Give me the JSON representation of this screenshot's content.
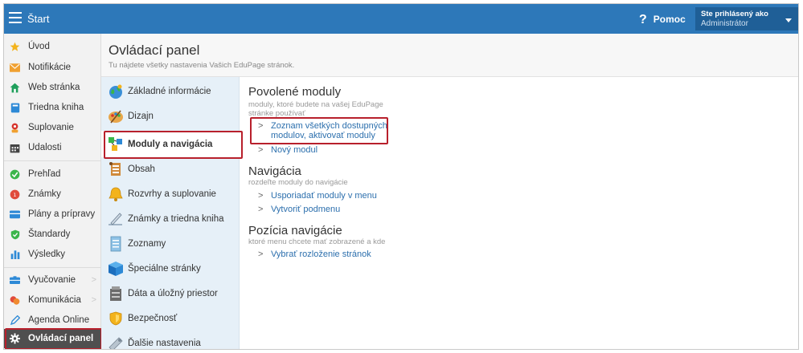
{
  "topbar": {
    "title": "Štart",
    "help_label": "Pomoc",
    "help_glyph": "?",
    "user_line1": "Ste prihlásený ako",
    "user_line2": "Administrátor"
  },
  "sidebar": {
    "items": [
      {
        "label": "Úvod",
        "icon": "star-icon"
      },
      {
        "label": "Notifikácie",
        "icon": "envelope-icon"
      },
      {
        "label": "Web stránka",
        "icon": "home-icon"
      },
      {
        "label": "Triedna kniha",
        "icon": "book-icon"
      },
      {
        "label": "Suplovanie",
        "icon": "substitution-icon"
      },
      {
        "label": "Udalosti",
        "icon": "calendar-icon"
      },
      {
        "label": "Prehľad",
        "icon": "check-icon"
      },
      {
        "label": "Známky",
        "icon": "grades-icon"
      },
      {
        "label": "Plány a prípravy",
        "icon": "plans-icon"
      },
      {
        "label": "Štandardy",
        "icon": "shield-check-icon"
      },
      {
        "label": "Výsledky",
        "icon": "bar-chart-icon"
      },
      {
        "label": "Vyučovanie",
        "icon": "teaching-icon"
      },
      {
        "label": "Komunikácia",
        "icon": "chat-icon"
      },
      {
        "label": "Agenda Online",
        "icon": "pen-icon"
      },
      {
        "label": "Ovládací panel",
        "icon": "gear-icon"
      }
    ],
    "chevron": ">"
  },
  "header": {
    "title": "Ovládací panel",
    "subtitle": "Tu nájdete všetky nastavenia Vašich EduPage stránok."
  },
  "categories": [
    {
      "label": "Základné informácie",
      "icon": "globe-icon"
    },
    {
      "label": "Dizajn",
      "icon": "palette-icon"
    },
    {
      "label": "Moduly a navigácia",
      "icon": "modules-icon"
    },
    {
      "label": "Obsah",
      "icon": "content-icon"
    },
    {
      "label": "Rozvrhy a suplovanie",
      "icon": "bell-icon"
    },
    {
      "label": "Známky a triedna kniha",
      "icon": "pencil-book-icon"
    },
    {
      "label": "Zoznamy",
      "icon": "list-icon"
    },
    {
      "label": "Špeciálne stránky",
      "icon": "cube-icon"
    },
    {
      "label": "Dáta a úložný priestor",
      "icon": "storage-icon"
    },
    {
      "label": "Bezpečnosť",
      "icon": "security-shield-icon"
    },
    {
      "label": "Ďalšie nastavenia",
      "icon": "settings-icon"
    }
  ],
  "sections": {
    "modules": {
      "title": "Povolené moduly",
      "desc": "moduly, ktoré budete na vašej EduPage stránke používať",
      "link1_line1": "Zoznam všetkých dostupných",
      "link1_line2": "modulov, aktivovať moduly",
      "link2": "Nový modul"
    },
    "navigation": {
      "title": "Navigácia",
      "desc": "rozdeľte moduly do navigácie",
      "link1": "Usporiadať moduly v menu",
      "link2": "Vytvoriť podmenu"
    },
    "position": {
      "title": "Pozícia navigácie",
      "desc": "ktoré menu chcete mať zobrazené a kde",
      "link1": "Vybrať rozloženie stránok"
    },
    "arrow": ">"
  },
  "colors": {
    "topbar": "#2d78b9",
    "accent_red": "#b8202c",
    "link": "#2c6fad"
  }
}
